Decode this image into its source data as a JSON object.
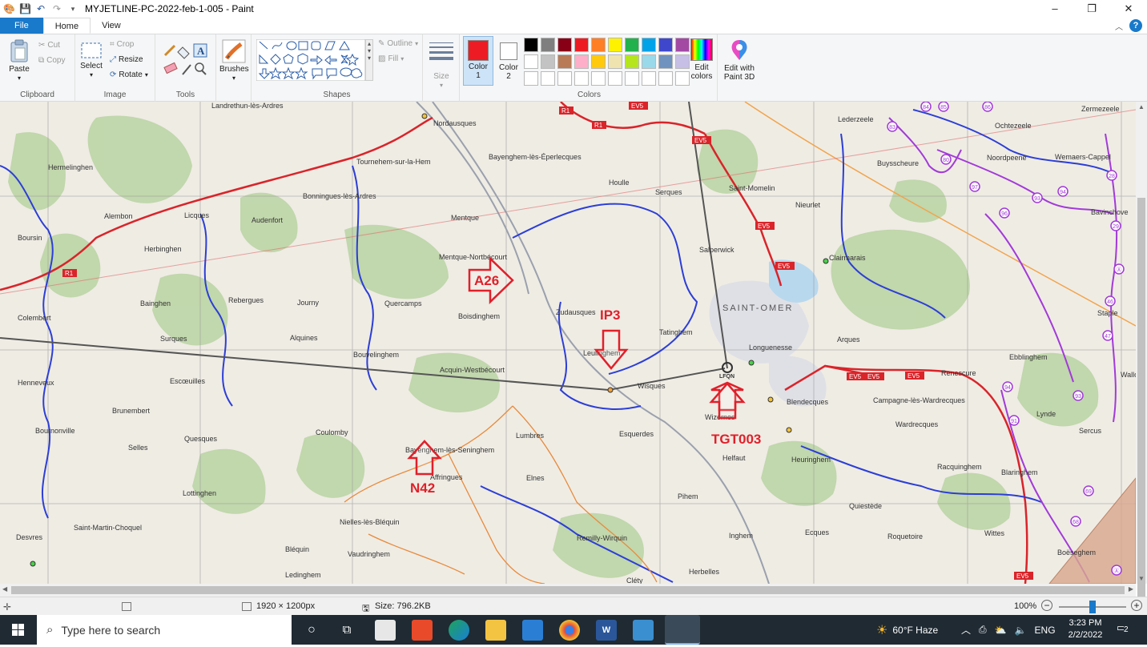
{
  "window": {
    "title": "MYJETLINE-PC-2022-feb-1-005 - Paint",
    "controls": [
      "–",
      "❐",
      "✕"
    ]
  },
  "tabs": {
    "file": "File",
    "home": "Home",
    "view": "View",
    "help": "?"
  },
  "ribbon": {
    "clipboard": {
      "label": "Clipboard",
      "paste": "Paste",
      "cut": "Cut",
      "copy": "Copy"
    },
    "image": {
      "label": "Image",
      "select": "Select",
      "crop": "Crop",
      "resize": "Resize",
      "rotate": "Rotate"
    },
    "tools": {
      "label": "Tools"
    },
    "brushes": {
      "label": "Brushes"
    },
    "shapes": {
      "label": "Shapes",
      "outline": "Outline",
      "fill": "Fill"
    },
    "size": {
      "label": "Size"
    },
    "color1": {
      "line1": "Color",
      "line2": "1",
      "value": "#ed1c24"
    },
    "color2": {
      "line1": "Color",
      "line2": "2",
      "value": "#ffffff"
    },
    "colors": {
      "label": "Colors",
      "edit_line1": "Edit",
      "edit_line2": "colors",
      "swatches": [
        "#000000",
        "#7f7f7f",
        "#880015",
        "#ed1c24",
        "#ff7f27",
        "#fff200",
        "#22b14c",
        "#00a2e8",
        "#3f48cc",
        "#a349a4",
        "#ffffff",
        "#c3c3c3",
        "#b97a57",
        "#ffaec9",
        "#ffc90e",
        "#efe4b0",
        "#b5e61d",
        "#99d9ea",
        "#7092be",
        "#c8bfe7",
        "#ffffff",
        "#ffffff",
        "#ffffff",
        "#ffffff",
        "#ffffff",
        "#ffffff",
        "#ffffff",
        "#ffffff",
        "#ffffff",
        "#ffffff"
      ]
    },
    "paint3d": {
      "line1": "Edit with",
      "line2": "Paint 3D"
    }
  },
  "map": {
    "places": [
      {
        "name": "Landrethun-lès-Ardres"
      },
      {
        "name": "Nordausques"
      },
      {
        "name": "Bayenghem-lès-Éperlecques"
      },
      {
        "name": "Tournehem-sur-la-Hem"
      },
      {
        "name": "Hermelinghen"
      },
      {
        "name": "Bonningues-lès-Ardres"
      },
      {
        "name": "Alembon"
      },
      {
        "name": "Licques"
      },
      {
        "name": "Audenfort"
      },
      {
        "name": "Boursin"
      },
      {
        "name": "Herbinghen"
      },
      {
        "name": "Mentque"
      },
      {
        "name": "Mentque-Nortbécourt"
      },
      {
        "name": "Houlle"
      },
      {
        "name": "Serques"
      },
      {
        "name": "Saint-Momelin"
      },
      {
        "name": "Nieurlet"
      },
      {
        "name": "Lederzeele"
      },
      {
        "name": "Buysscheure"
      },
      {
        "name": "Ochtezeele"
      },
      {
        "name": "Noordpeene"
      },
      {
        "name": "Zermezeele"
      },
      {
        "name": "Wemaers-Cappel"
      },
      {
        "name": "Bavinchove"
      },
      {
        "name": "Salperwick"
      },
      {
        "name": "Clairmarais"
      },
      {
        "name": "SAINT-OMER"
      },
      {
        "name": "Bainghen"
      },
      {
        "name": "Rebergues"
      },
      {
        "name": "Journy"
      },
      {
        "name": "Quercamps"
      },
      {
        "name": "Boisdinghem"
      },
      {
        "name": "Zudausques"
      },
      {
        "name": "Tatinghem"
      },
      {
        "name": "Longuenesse"
      },
      {
        "name": "Arques"
      },
      {
        "name": "Staple"
      },
      {
        "name": "Colembert"
      },
      {
        "name": "Surques"
      },
      {
        "name": "Alquines"
      },
      {
        "name": "Bouvelinghem"
      },
      {
        "name": "Leulinghem"
      },
      {
        "name": "Ebblinghem"
      },
      {
        "name": "Acquin-Westbécourt"
      },
      {
        "name": "Wisques"
      },
      {
        "name": "Renescure"
      },
      {
        "name": "Henneveux"
      },
      {
        "name": "Escœuilles"
      },
      {
        "name": "Blendecques"
      },
      {
        "name": "Campagne-lès-Wardrecques"
      },
      {
        "name": "Brunembert"
      },
      {
        "name": "Wizernes"
      },
      {
        "name": "Wardrecques"
      },
      {
        "name": "Lynde"
      },
      {
        "name": "Bournonville"
      },
      {
        "name": "Coulomby"
      },
      {
        "name": "Lumbres"
      },
      {
        "name": "Esquerdes"
      },
      {
        "name": "Sercus"
      },
      {
        "name": "Selles"
      },
      {
        "name": "Quesques"
      },
      {
        "name": "Bayenghem-lès-Seninghem"
      },
      {
        "name": "Helfaut"
      },
      {
        "name": "Heuringhem"
      },
      {
        "name": "Racquinghem"
      },
      {
        "name": "Affringues"
      },
      {
        "name": "Elnes"
      },
      {
        "name": "Blaringhem"
      },
      {
        "name": "Lottinghen"
      },
      {
        "name": "Pihem"
      },
      {
        "name": "Quiestède"
      },
      {
        "name": "Saint-Martin-Choquel"
      },
      {
        "name": "Nielles-lès-Bléquin"
      },
      {
        "name": "Remilly-Wirquin"
      },
      {
        "name": "Inghem"
      },
      {
        "name": "Ecques"
      },
      {
        "name": "Roquetoire"
      },
      {
        "name": "Wittes"
      },
      {
        "name": "Desvres"
      },
      {
        "name": "Bléquin"
      },
      {
        "name": "Vaudringhem"
      },
      {
        "name": "Boëseghem"
      },
      {
        "name": "Ledinghem"
      },
      {
        "name": "Herbelles"
      },
      {
        "name": "Cléty"
      },
      {
        "name": "LFQN"
      },
      {
        "name": "Wallon"
      }
    ],
    "road_labels": [
      "R1",
      "R1",
      "R1",
      "EV5",
      "EV5",
      "EV5",
      "EV5",
      "EV5",
      "EV5",
      "EV5",
      "EV5"
    ],
    "cycle_labels": [
      "84",
      "85",
      "86",
      "83",
      "80",
      "97",
      "93",
      "94",
      "28",
      "96",
      "29",
      "Ⓐ",
      "46",
      "47",
      "94",
      "93",
      "91",
      "69",
      "68",
      "Ⓐ"
    ],
    "annotations": [
      {
        "text": "A26"
      },
      {
        "text": "IP3"
      },
      {
        "text": "TGT003"
      },
      {
        "text": "N42"
      }
    ]
  },
  "statusbar": {
    "dimensions": "1920 × 1200px",
    "size": "Size: 796.2KB",
    "zoom": "100%"
  },
  "taskbar": {
    "search_placeholder": "Type here to search",
    "weather": "60°F  Haze",
    "lang": "ENG",
    "time": "3:23 PM",
    "date": "2/2/2022",
    "notifications": "2"
  }
}
